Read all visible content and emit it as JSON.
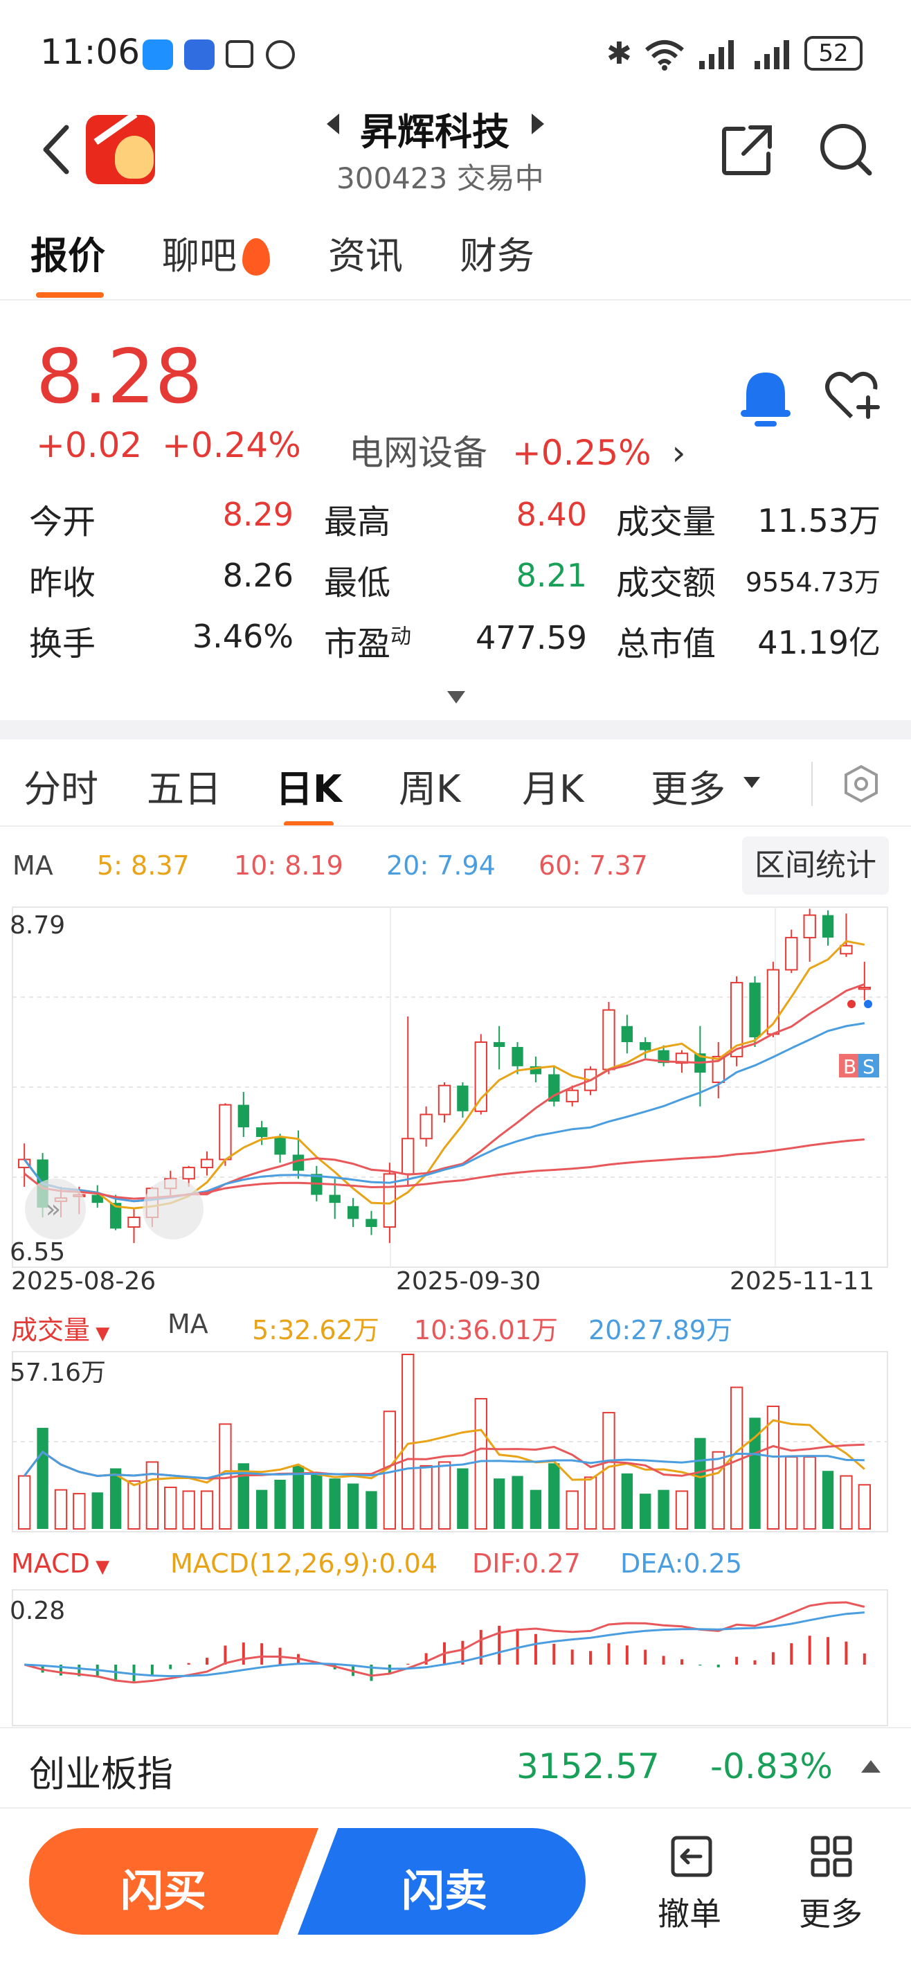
{
  "status_bar": {
    "time": "11:06",
    "battery": "52",
    "icons": [
      "chat-app-icon",
      "shield-app-icon",
      "nfc-icon",
      "alarm-icon",
      "bluetooth-icon",
      "wifi-icon",
      "signal-icon",
      "signal-icon-2",
      "battery-icon"
    ]
  },
  "header": {
    "stock_name": "昇辉科技",
    "stock_code_status": "300423 交易中"
  },
  "tabs": [
    {
      "label": "报价",
      "active": true
    },
    {
      "label": "聊吧"
    },
    {
      "label": "资讯"
    },
    {
      "label": "财务"
    }
  ],
  "quote": {
    "price": "8.28",
    "change": "+0.02",
    "change_pct": "+0.24%",
    "sector_name": "电网设备",
    "sector_pct": "+0.25%",
    "stats": {
      "open_label": "今开",
      "open": "8.29",
      "high_label": "最高",
      "high": "8.40",
      "volume_label": "成交量",
      "volume": "11.53万",
      "prev_close_label": "昨收",
      "prev_close": "8.26",
      "low_label": "最低",
      "low": "8.21",
      "amount_label": "成交额",
      "amount": "9554.73万",
      "turnover_label": "换手",
      "turnover": "3.46%",
      "pe_label": "市盈",
      "pe_sup": "动",
      "pe": "477.59",
      "mcap_label": "总市值",
      "mcap": "41.19亿"
    }
  },
  "kline_tabs": [
    {
      "label": "分时"
    },
    {
      "label": "五日"
    },
    {
      "label": "日K",
      "active": true
    },
    {
      "label": "周K"
    },
    {
      "label": "月K"
    },
    {
      "label": "更多"
    }
  ],
  "ma_legend": {
    "title": "MA",
    "ma5": "5: 8.37",
    "ma10": "10: 8.19",
    "ma20": "20: 7.94",
    "ma60": "60: 7.37",
    "range_button": "区间统计"
  },
  "volume_legend": {
    "title": "成交量",
    "ma_label": "MA",
    "ma5": "5:32.62万",
    "ma10": "10:36.01万",
    "ma20": "20:27.89万"
  },
  "macd_legend": {
    "title": "MACD",
    "params": "MACD(12,26,9):0.04",
    "dif": "DIF:0.27",
    "dea": "DEA:0.25"
  },
  "index_bar": {
    "name": "创业板指",
    "value": "3152.57",
    "pct": "-0.83%"
  },
  "actions": {
    "buy": "闪买",
    "sell": "闪卖",
    "cancel": "撤单",
    "more": "更多"
  },
  "colors": {
    "up": "#e53935",
    "down": "#18a058",
    "accent": "#ff6a1a",
    "sell_blue": "#1e74f0",
    "ma5": "#e8a316",
    "ma10": "#e8585a",
    "ma20": "#4a9ee0"
  },
  "chart_data": [
    {
      "type": "candlestick",
      "ylim": [
        6.55,
        8.79
      ],
      "ytick_labels": [
        "8.79",
        "6.55"
      ],
      "x_labels": [
        "2025-08-26",
        "2025-09-30",
        "2025-11-11"
      ],
      "series": [
        {
          "name": "K",
          "ohlc": [
            [
              7.17,
              7.32,
              7.05,
              7.22
            ],
            [
              7.22,
              7.26,
              6.86,
              6.92
            ],
            [
              6.96,
              7.05,
              6.86,
              6.98
            ],
            [
              6.99,
              7.05,
              6.88,
              7.0
            ],
            [
              7.0,
              7.06,
              6.92,
              6.95
            ],
            [
              6.95,
              7.0,
              6.78,
              6.79
            ],
            [
              6.8,
              6.92,
              6.7,
              6.86
            ],
            [
              6.86,
              7.05,
              6.8,
              7.04
            ],
            [
              7.04,
              7.15,
              6.98,
              7.1
            ],
            [
              7.1,
              7.18,
              7.05,
              7.17
            ],
            [
              7.17,
              7.27,
              7.12,
              7.22
            ],
            [
              7.22,
              7.57,
              7.18,
              7.56
            ],
            [
              7.56,
              7.64,
              7.36,
              7.42
            ],
            [
              7.42,
              7.46,
              7.31,
              7.36
            ],
            [
              7.36,
              7.38,
              7.2,
              7.25
            ],
            [
              7.25,
              7.4,
              7.1,
              7.15
            ],
            [
              7.13,
              7.18,
              6.96,
              7.0
            ],
            [
              7.0,
              7.1,
              6.85,
              6.95
            ],
            [
              6.93,
              6.98,
              6.8,
              6.85
            ],
            [
              6.85,
              6.9,
              6.75,
              6.8
            ],
            [
              6.8,
              7.2,
              6.7,
              7.13
            ],
            [
              7.13,
              8.11,
              7.05,
              7.35
            ],
            [
              7.35,
              7.55,
              7.3,
              7.5
            ],
            [
              7.5,
              7.7,
              7.45,
              7.68
            ],
            [
              7.68,
              7.7,
              7.48,
              7.52
            ],
            [
              7.52,
              8.0,
              7.5,
              7.95
            ],
            [
              7.95,
              8.05,
              7.78,
              7.92
            ],
            [
              7.92,
              7.95,
              7.75,
              7.8
            ],
            [
              7.8,
              7.86,
              7.7,
              7.75
            ],
            [
              7.75,
              7.8,
              7.55,
              7.58
            ],
            [
              7.58,
              7.68,
              7.55,
              7.65
            ],
            [
              7.65,
              7.8,
              7.62,
              7.78
            ],
            [
              7.78,
              8.2,
              7.75,
              8.15
            ],
            [
              8.05,
              8.12,
              7.88,
              7.95
            ],
            [
              7.95,
              7.98,
              7.85,
              7.9
            ],
            [
              7.9,
              7.93,
              7.8,
              7.82
            ],
            [
              7.82,
              7.9,
              7.76,
              7.88
            ],
            [
              7.88,
              8.05,
              7.55,
              7.76
            ],
            [
              7.7,
              7.95,
              7.6,
              7.86
            ],
            [
              7.86,
              8.36,
              7.8,
              8.32
            ],
            [
              8.32,
              8.36,
              7.92,
              7.98
            ],
            [
              8.0,
              8.45,
              7.98,
              8.4
            ],
            [
              8.4,
              8.65,
              8.38,
              8.6
            ],
            [
              8.6,
              8.78,
              8.45,
              8.74
            ],
            [
              8.74,
              8.77,
              8.55,
              8.6
            ],
            [
              8.5,
              8.75,
              8.48,
              8.55
            ],
            [
              8.28,
              8.45,
              8.21,
              8.29
            ]
          ]
        }
      ]
    },
    {
      "type": "bar",
      "title": "成交量",
      "ytick_labels": [
        "57.16万"
      ]
    },
    {
      "type": "bar",
      "title": "MACD",
      "ytick_labels": [
        "0.28"
      ]
    }
  ]
}
